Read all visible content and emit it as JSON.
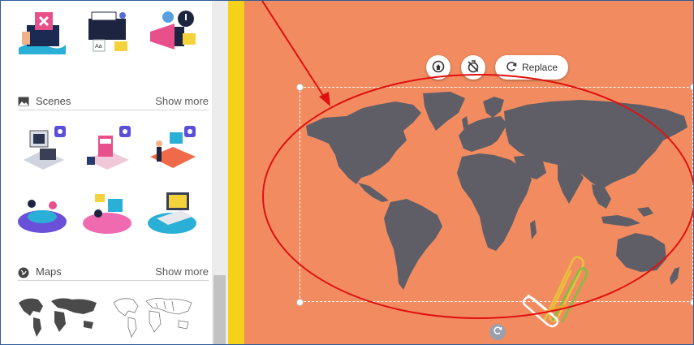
{
  "panel": {
    "scenes": {
      "title": "Scenes",
      "show_more": "Show more"
    },
    "maps": {
      "title": "Maps",
      "show_more": "Show more"
    }
  },
  "toolbar": {
    "replace_label": "Replace",
    "icons": [
      "lock-icon",
      "unlock-icon",
      "refresh-icon"
    ]
  },
  "colors": {
    "canvas_bg": "#f28c60",
    "accent_strip": "#f5d11a",
    "map_land": "#5f5e67",
    "annotation": "#e01010"
  }
}
